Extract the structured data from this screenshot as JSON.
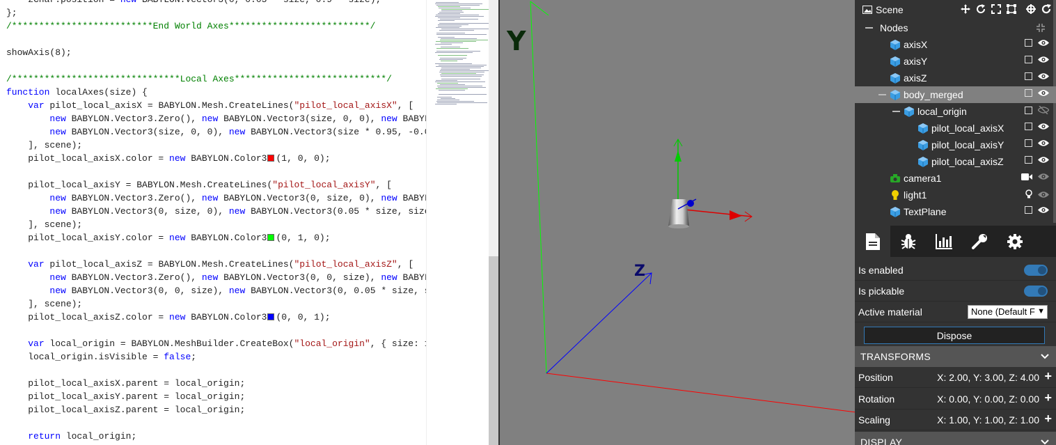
{
  "editor": {
    "lines": [
      [
        [
          "",
          "    zChar.position = "
        ],
        [
          "kw",
          "new"
        ],
        [
          "",
          " BABYLON.Vector3(0, 0.05 * size, 0.9 * size);"
        ]
      ],
      [
        [
          "",
          "};"
        ]
      ],
      [
        [
          "cm",
          "/**************************End World Axes**************************/"
        ]
      ],
      [
        [
          "",
          ""
        ]
      ],
      [
        [
          "",
          "showAxis(8);"
        ]
      ],
      [
        [
          "",
          ""
        ]
      ],
      [
        [
          "cm",
          "/*******************************Local Axes****************************/"
        ]
      ],
      [
        [
          "kw",
          "function"
        ],
        [
          "",
          " localAxes(size) {"
        ]
      ],
      [
        [
          "",
          "    "
        ],
        [
          "kw",
          "var"
        ],
        [
          "",
          " pilot_local_axisX = BABYLON.Mesh.CreateLines("
        ],
        [
          "str",
          "\"pilot_local_axisX\""
        ],
        [
          "",
          ", ["
        ]
      ],
      [
        [
          "",
          "        "
        ],
        [
          "kw",
          "new"
        ],
        [
          "",
          " BABYLON.Vector3.Zero(), "
        ],
        [
          "kw",
          "new"
        ],
        [
          "",
          " BABYLON.Vector3(size, 0, 0), "
        ],
        [
          "kw",
          "new"
        ],
        [
          "",
          " BABYLON"
        ]
      ],
      [
        [
          "",
          "        "
        ],
        [
          "kw",
          "new"
        ],
        [
          "",
          " BABYLON.Vector3(size, 0, 0), "
        ],
        [
          "kw",
          "new"
        ],
        [
          "",
          " BABYLON.Vector3(size * 0.95, -0.0"
        ]
      ],
      [
        [
          "",
          "    ], scene);"
        ]
      ],
      [
        [
          "",
          "    pilot_local_axisX.color = "
        ],
        [
          "kw",
          "new"
        ],
        [
          "",
          " BABYLON.Color3"
        ],
        [
          "sw",
          "#ff0000"
        ],
        [
          "",
          "(1, 0, 0);"
        ]
      ],
      [
        [
          "",
          ""
        ]
      ],
      [
        [
          "",
          "    pilot_local_axisY = BABYLON.Mesh.CreateLines("
        ],
        [
          "str",
          "\"pilot_local_axisY\""
        ],
        [
          "",
          ", ["
        ]
      ],
      [
        [
          "",
          "        "
        ],
        [
          "kw",
          "new"
        ],
        [
          "",
          " BABYLON.Vector3.Zero(), "
        ],
        [
          "kw",
          "new"
        ],
        [
          "",
          " BABYLON.Vector3(0, size, 0), "
        ],
        [
          "kw",
          "new"
        ],
        [
          "",
          " BABYLON"
        ]
      ],
      [
        [
          "",
          "        "
        ],
        [
          "kw",
          "new"
        ],
        [
          "",
          " BABYLON.Vector3(0, size, 0), "
        ],
        [
          "kw",
          "new"
        ],
        [
          "",
          " BABYLON.Vector3(0.05 * size, size"
        ]
      ],
      [
        [
          "",
          "    ], scene);"
        ]
      ],
      [
        [
          "",
          "    pilot_local_axisY.color = "
        ],
        [
          "kw",
          "new"
        ],
        [
          "",
          " BABYLON.Color3"
        ],
        [
          "sw",
          "#00ff00"
        ],
        [
          "",
          "(0, 1, 0);"
        ]
      ],
      [
        [
          "",
          ""
        ]
      ],
      [
        [
          "",
          "    "
        ],
        [
          "kw",
          "var"
        ],
        [
          "",
          " pilot_local_axisZ = BABYLON.Mesh.CreateLines("
        ],
        [
          "str",
          "\"pilot_local_axisZ\""
        ],
        [
          "",
          ", ["
        ]
      ],
      [
        [
          "",
          "        "
        ],
        [
          "kw",
          "new"
        ],
        [
          "",
          " BABYLON.Vector3.Zero(), "
        ],
        [
          "kw",
          "new"
        ],
        [
          "",
          " BABYLON.Vector3(0, 0, size), "
        ],
        [
          "kw",
          "new"
        ],
        [
          "",
          " BABYLON"
        ]
      ],
      [
        [
          "",
          "        "
        ],
        [
          "kw",
          "new"
        ],
        [
          "",
          " BABYLON.Vector3(0, 0, size), "
        ],
        [
          "kw",
          "new"
        ],
        [
          "",
          " BABYLON.Vector3(0, 0.05 * size, s"
        ]
      ],
      [
        [
          "",
          "    ], scene);"
        ]
      ],
      [
        [
          "",
          "    pilot_local_axisZ.color = "
        ],
        [
          "kw",
          "new"
        ],
        [
          "",
          " BABYLON.Color3"
        ],
        [
          "sw",
          "#0000ff"
        ],
        [
          "",
          "(0, 0, 1);"
        ]
      ],
      [
        [
          "",
          ""
        ]
      ],
      [
        [
          "",
          "    "
        ],
        [
          "kw",
          "var"
        ],
        [
          "",
          " local_origin = BABYLON.MeshBuilder.CreateBox("
        ],
        [
          "str",
          "\"local_origin\""
        ],
        [
          "",
          ", { size: 1"
        ]
      ],
      [
        [
          "",
          "    local_origin.isVisible = "
        ],
        [
          "kw",
          "false"
        ],
        [
          "",
          ";"
        ]
      ],
      [
        [
          "",
          ""
        ]
      ],
      [
        [
          "",
          "    pilot_local_axisX.parent = local_origin;"
        ]
      ],
      [
        [
          "",
          "    pilot_local_axisY.parent = local_origin;"
        ]
      ],
      [
        [
          "",
          "    pilot_local_axisZ.parent = local_origin;"
        ]
      ],
      [
        [
          "",
          ""
        ]
      ],
      [
        [
          "",
          "    "
        ],
        [
          "kw",
          "return"
        ],
        [
          "",
          " local_origin;"
        ]
      ]
    ]
  },
  "viewport": {
    "labels": {
      "y": "Y",
      "z": "Z"
    },
    "colors": {
      "x": "#ff0000",
      "y": "#00ff00",
      "z": "#0000ff",
      "background": "#808080"
    }
  },
  "inspector": {
    "scene_label": "Scene",
    "nodes_label": "Nodes",
    "tree": [
      {
        "label": "axisX",
        "icon": "mesh-icon",
        "depth": 1,
        "visible": true
      },
      {
        "label": "axisY",
        "icon": "mesh-icon",
        "depth": 1,
        "visible": true
      },
      {
        "label": "axisZ",
        "icon": "mesh-icon",
        "depth": 1,
        "visible": true
      },
      {
        "label": "body_merged",
        "icon": "mesh-icon",
        "depth": 1,
        "visible": true,
        "selected": true,
        "expanded": true
      },
      {
        "label": "local_origin",
        "icon": "mesh-icon",
        "depth": 2,
        "visible": false,
        "expanded": true
      },
      {
        "label": "pilot_local_axisX",
        "icon": "mesh-icon",
        "depth": 3,
        "visible": true
      },
      {
        "label": "pilot_local_axisY",
        "icon": "mesh-icon",
        "depth": 3,
        "visible": true
      },
      {
        "label": "pilot_local_axisZ",
        "icon": "mesh-icon",
        "depth": 3,
        "visible": true
      },
      {
        "label": "camera1",
        "icon": "camera-icon",
        "depth": 1,
        "visible": true
      },
      {
        "label": "light1",
        "icon": "light-icon",
        "depth": 1,
        "visible": true
      },
      {
        "label": "TextPlane",
        "icon": "mesh-icon",
        "depth": 1,
        "visible": true
      }
    ],
    "tabs": [
      "properties-tab",
      "debug-tab",
      "statistics-tab",
      "tools-tab",
      "settings-tab"
    ],
    "props": {
      "is_enabled_label": "Is enabled",
      "is_pickable_label": "Is pickable",
      "active_material_label": "Active material",
      "active_material_value": "None (Default F",
      "dispose_label": "Dispose",
      "transforms_label": "TRANSFORMS",
      "position_label": "Position",
      "position_value": "X: 2.00, Y: 3.00, Z: 4.00",
      "rotation_label": "Rotation",
      "rotation_value": "X: 0.00, Y: 0.00, Z: 0.00",
      "scaling_label": "Scaling",
      "scaling_value": "X: 1.00, Y: 1.00, Z: 1.00",
      "display_label": "DISPLAY"
    },
    "accent": "#337ab7"
  }
}
